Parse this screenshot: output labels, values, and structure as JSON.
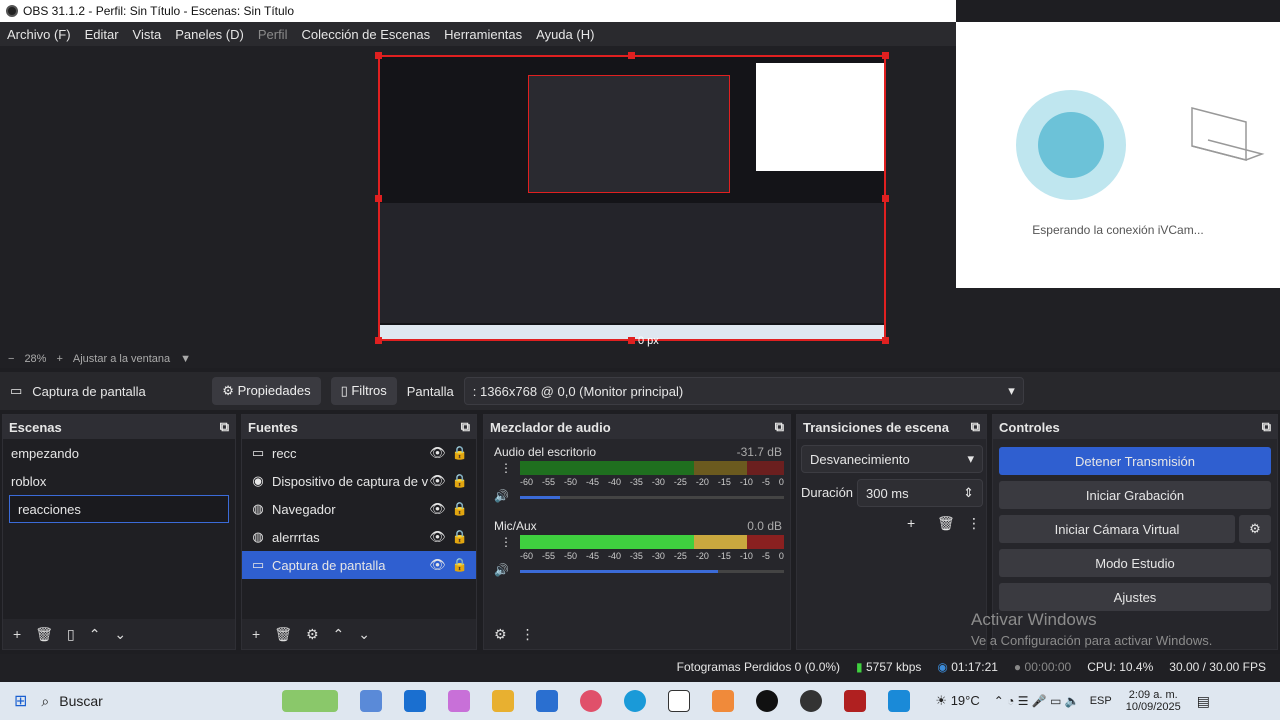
{
  "window": {
    "title": "OBS 31.1.2 - Perfil: Sin Título - Escenas: Sin Título"
  },
  "menu": [
    "Archivo (F)",
    "Editar",
    "Vista",
    "Paneles (D)",
    "Perfil",
    "Colección de Escenas",
    "Herramientas",
    "Ayuda (H)"
  ],
  "preview": {
    "zoom": "28%",
    "fit": "Ajustar a la ventana",
    "offset": "0 px"
  },
  "ivcam": {
    "status": "Esperando la conexión iVCam..."
  },
  "source_bar": {
    "name": "Captura de pantalla",
    "properties": "Propiedades",
    "filters": "Filtros",
    "display_label": "Pantalla",
    "display_value": ": 1366x768 @ 0,0 (Monitor principal)"
  },
  "scenes": {
    "title": "Escenas",
    "items": [
      "empezando",
      "roblox",
      "reacciones"
    ],
    "selected": "reacciones"
  },
  "sources": {
    "title": "Fuentes",
    "items": [
      "recc",
      "Dispositivo de captura de v",
      "Navegador",
      "alerrrtas",
      "Captura de pantalla"
    ],
    "selected": "Captura de pantalla"
  },
  "mixer": {
    "title": "Mezclador de audio",
    "channels": [
      {
        "name": "Audio del escritorio",
        "db": "-31.7 dB",
        "level": 0.15
      },
      {
        "name": "Mic/Aux",
        "db": "0.0 dB",
        "level": 0.75
      }
    ],
    "scale": [
      "-60",
      "-55",
      "-50",
      "-45",
      "-40",
      "-35",
      "-30",
      "-25",
      "-20",
      "-15",
      "-10",
      "-5",
      "0"
    ]
  },
  "transitions": {
    "title": "Transiciones de escena",
    "type": "Desvanecimiento",
    "duration_label": "Duración",
    "duration": "300 ms"
  },
  "controls": {
    "title": "Controles",
    "stop_stream": "Detener Transmisión",
    "start_rec": "Iniciar Grabación",
    "virtual_cam": "Iniciar Cámara Virtual",
    "studio": "Modo Estudio",
    "settings": "Ajustes"
  },
  "status": {
    "dropped": "Fotogramas Perdidos 0 (0.0%)",
    "kbps": "5757 kbps",
    "time": "01:17:21",
    "rec_time": "00:00:00",
    "cpu": "CPU: 10.4%",
    "fps": "30.00 / 30.00 FPS"
  },
  "watermark": {
    "title": "Activar Windows",
    "sub": "Ve a Configuración para activar Windows."
  },
  "taskbar": {
    "search": "Buscar",
    "temp": "19°C",
    "lang": "ESP",
    "time": "2:09 a. m.",
    "date": "10/09/2025"
  }
}
